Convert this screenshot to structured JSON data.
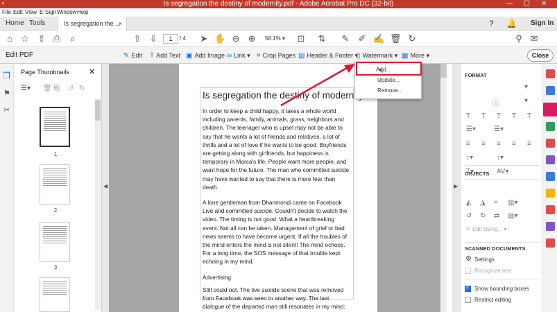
{
  "window": {
    "title": "Is segregation the destiny of modernity.pdf - Adobe Acrobat Pro DC (32-bit)",
    "minimize": "—",
    "maximize": "☐",
    "close": "✕"
  },
  "menu": [
    "File",
    "Edit",
    "View",
    "E-Sign",
    "Window",
    "Help"
  ],
  "tabs": {
    "home": "Home",
    "tools": "Tools",
    "document": "Is segregation the ...",
    "document_close": "×",
    "sign_in": "Sign In"
  },
  "toolbar": {
    "page_current": "1",
    "page_total": "/ 4",
    "zoom": "58.1%"
  },
  "edit_bar": {
    "title": "Edit PDF",
    "edit": "Edit",
    "add_text": "Add Text",
    "add_image": "Add Image",
    "link": "Link",
    "crop_pages": "Crop Pages",
    "header_footer": "Header & Footer",
    "watermark": "Watermark",
    "more": "More",
    "close": "Close"
  },
  "watermark_menu": [
    "Add...",
    "Update...",
    "Remove..."
  ],
  "thumbnails": {
    "title": "Page Thumbnails",
    "pages": [
      "1",
      "2",
      "3"
    ]
  },
  "document": {
    "title": "Is segregation the destiny of modernity?",
    "paragraphs": [
      "In order to keep a child happy, it takes a whole world including parents, family, animals, grass, neighbors and children. The teenager who is upset may not be able to say that he wants a lot of friends and relatives, a lot of thrills and a lot of love if he wants to be good. Boyfriends are getting along with girlfriends, but happiness is temporary in Marca's life. People want more people, and want hope for the future. The man who committed suicide may have wanted to say that there is more fear than death.",
      "A lone gentleman from Dhanmondi came on Facebook Live and committed suicide. Couldn't decide to watch the video. The timing is not good. What a heartbreaking event. Not all can be taken. Management of grief or bad news seems to have become urgent. If all the troubles of the mind enters the mind is not silent! The mind echoes. For a long time, the SOS message of that trouble kept echoing in my mind.",
      "Advertising",
      "Still could not. The live suicide scene that was removed from Facebook was seen in another way. The last dialogue of the departed man still resonates in my mind:"
    ]
  },
  "right_panel": {
    "format": "FORMAT",
    "objects": "OBJECTS",
    "edit_using": "Edit Using...",
    "scanned": "SCANNED DOCUMENTS",
    "settings": "Settings",
    "recognize": "Recognize text",
    "show_boxes": "Show bounding boxes",
    "restrict": "Restrict editing",
    "show_boxes_checked": true,
    "restrict_checked": false
  },
  "colors": {
    "titlebar": "#c0392b",
    "accent": "#1a73e8",
    "highlight": "#e0142f",
    "doc_bg": "#a6a6a6"
  }
}
